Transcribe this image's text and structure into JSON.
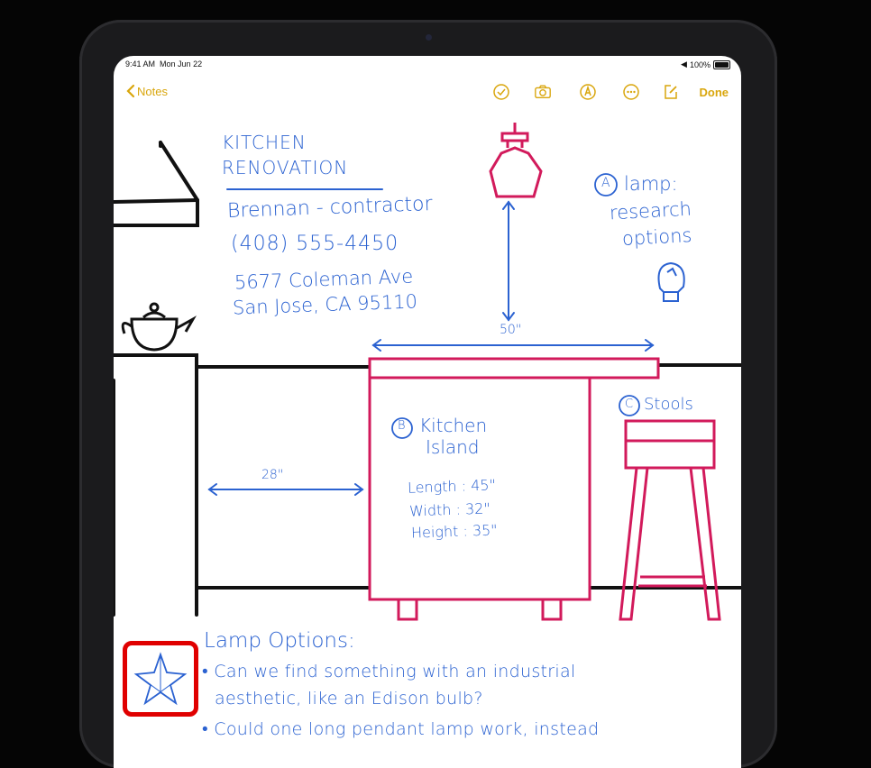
{
  "status_bar": {
    "time": "9:41 AM",
    "date": "Mon Jun 22",
    "battery": "100%"
  },
  "toolbar": {
    "back_label": "Notes",
    "done_label": "Done",
    "icons": [
      "checklist-icon",
      "camera-icon",
      "markup-icon",
      "more-icon",
      "compose-icon"
    ]
  },
  "note": {
    "title_line1": "KITCHEN",
    "title_line2": "RENOVATION",
    "contact_name": "Brennan - contractor",
    "phone": "(408) 555-4450",
    "address_line1": "5677 Coleman Ave",
    "address_line2": "San Jose, CA 95110",
    "lamp_badge": "A",
    "lamp_line1": "lamp:",
    "lamp_line2": "research",
    "lamp_line3": "options",
    "width_dimension": "50\"",
    "gap_dimension": "28\"",
    "island_badge": "B",
    "island_line1": "Kitchen",
    "island_line2": "Island",
    "length": "Length : 45\"",
    "width": "Width : 32\"",
    "height": "Height : 35\"",
    "stools_badge": "C",
    "stools_label": "Stools",
    "options_heading": "Lamp Options:",
    "bullet1_line1": "Can we find something with an industrial",
    "bullet1_line2": "aesthetic, like an Edison bulb?",
    "bullet2_line1": "Could one long pendant lamp work, instead"
  },
  "colors": {
    "accent": "#d9a60c",
    "ink_blue": "#2b62d1",
    "ink_pink": "#d21a5b",
    "highlight": "#e00000"
  }
}
